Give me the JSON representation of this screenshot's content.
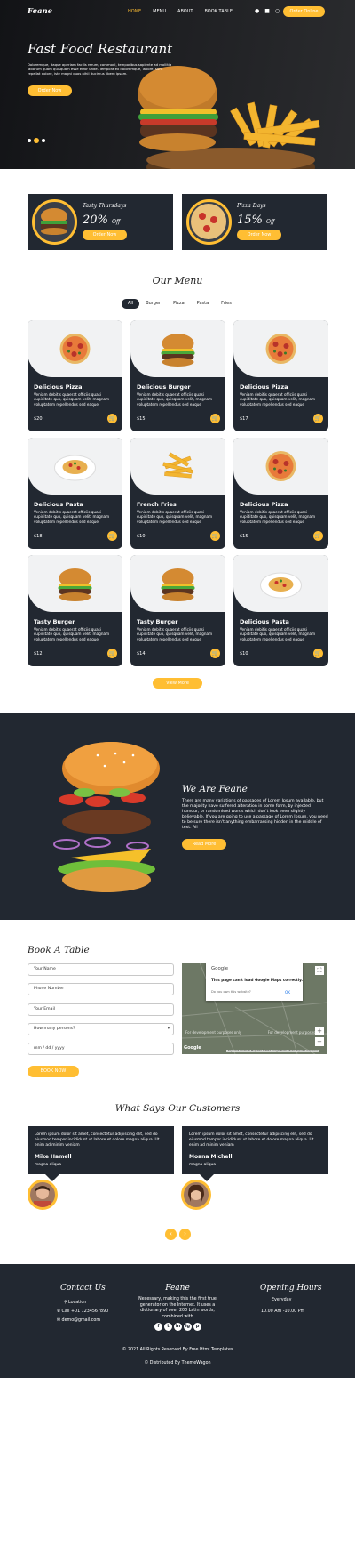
{
  "nav": {
    "brand": "Feane",
    "links": [
      "HOME",
      "MENU",
      "ABOUT",
      "BOOK TABLE"
    ],
    "order_button": "Order Online",
    "icons": [
      "user-icon",
      "cart-icon",
      "search-icon"
    ]
  },
  "hero": {
    "title": "Fast Food Restaurant",
    "text": "Doloremque, itaque aperiam facilis rerum, commodi, temporibus sapiente ad mollitia laborum quam quisquam esse error unde. Tempora ex doloremque, labore, sunt repellat dolore, iste magni quos nihil ducimus libero ipsam.",
    "button": "Order Now",
    "slides": 3,
    "active_slide": 1
  },
  "offers": [
    {
      "title": "Tasty Thursdays",
      "percent": "20%",
      "suffix": "Off",
      "button": "Order Now"
    },
    {
      "title": "Pizza Days",
      "percent": "15%",
      "suffix": "Off",
      "button": "Order Now"
    }
  ],
  "menu": {
    "title": "Our Menu",
    "filters": [
      "All",
      "Burger",
      "Pizza",
      "Pasta",
      "Fries"
    ],
    "active_filter": "All",
    "items": [
      {
        "name": "Delicious Pizza",
        "desc": "Veniam debitis quaerat officiis quasi cupiditate quo, quisquam velit, magnam voluptatem repellendus sed eaque",
        "price": "$20",
        "dish": "pizza"
      },
      {
        "name": "Delicious Burger",
        "desc": "Veniam debitis quaerat officiis quasi cupiditate quo, quisquam velit, magnam voluptatem repellendus sed eaque",
        "price": "$15",
        "dish": "burger"
      },
      {
        "name": "Delicious Pizza",
        "desc": "Veniam debitis quaerat officiis quasi cupiditate quo, quisquam velit, magnam voluptatem repellendus sed eaque",
        "price": "$17",
        "dish": "pizza"
      },
      {
        "name": "Delicious Pasta",
        "desc": "Veniam debitis quaerat officiis quasi cupiditate quo, quisquam velit, magnam voluptatem repellendus sed eaque",
        "price": "$18",
        "dish": "pasta"
      },
      {
        "name": "French Fries",
        "desc": "Veniam debitis quaerat officiis quasi cupiditate quo, quisquam velit, magnam voluptatem repellendus sed eaque",
        "price": "$10",
        "dish": "fries"
      },
      {
        "name": "Delicious Pizza",
        "desc": "Veniam debitis quaerat officiis quasi cupiditate quo, quisquam velit, magnam voluptatem repellendus sed eaque",
        "price": "$15",
        "dish": "pizza"
      },
      {
        "name": "Tasty Burger",
        "desc": "Veniam debitis quaerat officiis quasi cupiditate quo, quisquam velit, magnam voluptatem repellendus sed eaque",
        "price": "$12",
        "dish": "burger"
      },
      {
        "name": "Tasty Burger",
        "desc": "Veniam debitis quaerat officiis quasi cupiditate quo, quisquam velit, magnam voluptatem repellendus sed eaque",
        "price": "$14",
        "dish": "burger"
      },
      {
        "name": "Delicious Pasta",
        "desc": "Veniam debitis quaerat officiis quasi cupiditate quo, quisquam velit, magnam voluptatem repellendus sed eaque",
        "price": "$10",
        "dish": "pasta"
      }
    ],
    "view_more": "View More"
  },
  "about": {
    "title": "We Are Feane",
    "text": "There are many variations of passages of Lorem Ipsum available, but the majority have suffered alteration in some form, by injected humour, or randomised words which don't look even slightly believable. If you are going to use a passage of Lorem Ipsum, you need to be sure there isn't anything embarrassing hidden in the middle of text. All",
    "button": "Read More"
  },
  "book": {
    "title": "Book A Table",
    "fields": {
      "name": "Your Name",
      "phone": "Phone Number",
      "email": "Your Email",
      "persons": "How many persons?",
      "date": "mm / dd / yyyy"
    },
    "button": "BOOK NOW",
    "map": {
      "dialog_brand": "Google",
      "dialog_msg": "This page can't load Google Maps correctly.",
      "dialog_q": "Do you own this website?",
      "dialog_ok": "OK",
      "overlay": "For development purposes only",
      "footer": "Keyboard shortcuts  Map data ©2021 Google  Terms of Use  Report a map error",
      "logo": "Google"
    }
  },
  "testimonials": {
    "title": "What Says Our Customers",
    "items": [
      {
        "quote": "Lorem ipsum dolor sit amet, consectetur adipiscing elit, sed do eiusmod tempor incididunt ut labore et dolore magna aliqua. Ut enim ad minim veniam",
        "name": "Mike Hamell",
        "role": "magna aliqua"
      },
      {
        "quote": "Lorem ipsum dolor sit amet, consectetur adipiscing elit, sed do eiusmod tempor incididunt ut labore et dolore magna aliqua. Ut enim ad minim veniam",
        "name": "Moana Michell",
        "role": "magna aliqua"
      }
    ],
    "prev": "‹",
    "next": "›"
  },
  "footer": {
    "contact": {
      "title": "Contact Us",
      "location": "Location",
      "phone": "Call +01 1234567890",
      "email": "demo@gmail.com"
    },
    "brand": {
      "title": "Feane",
      "text": "Necessary, making this the first true generator on the Internet. It uses a dictionary of over 200 Latin words, combined with",
      "social": [
        "f",
        "t",
        "in",
        "ig",
        "p"
      ]
    },
    "hours": {
      "title": "Opening Hours",
      "days": "Everyday",
      "time": "10.00 Am -10.00 Pm"
    },
    "copyright": "© 2021 All Rights Reserved By Free Html Templates",
    "distributed": "© Distributed By ThemeWagon"
  },
  "colors": {
    "accent": "#ffbe33",
    "dark": "#222831"
  }
}
